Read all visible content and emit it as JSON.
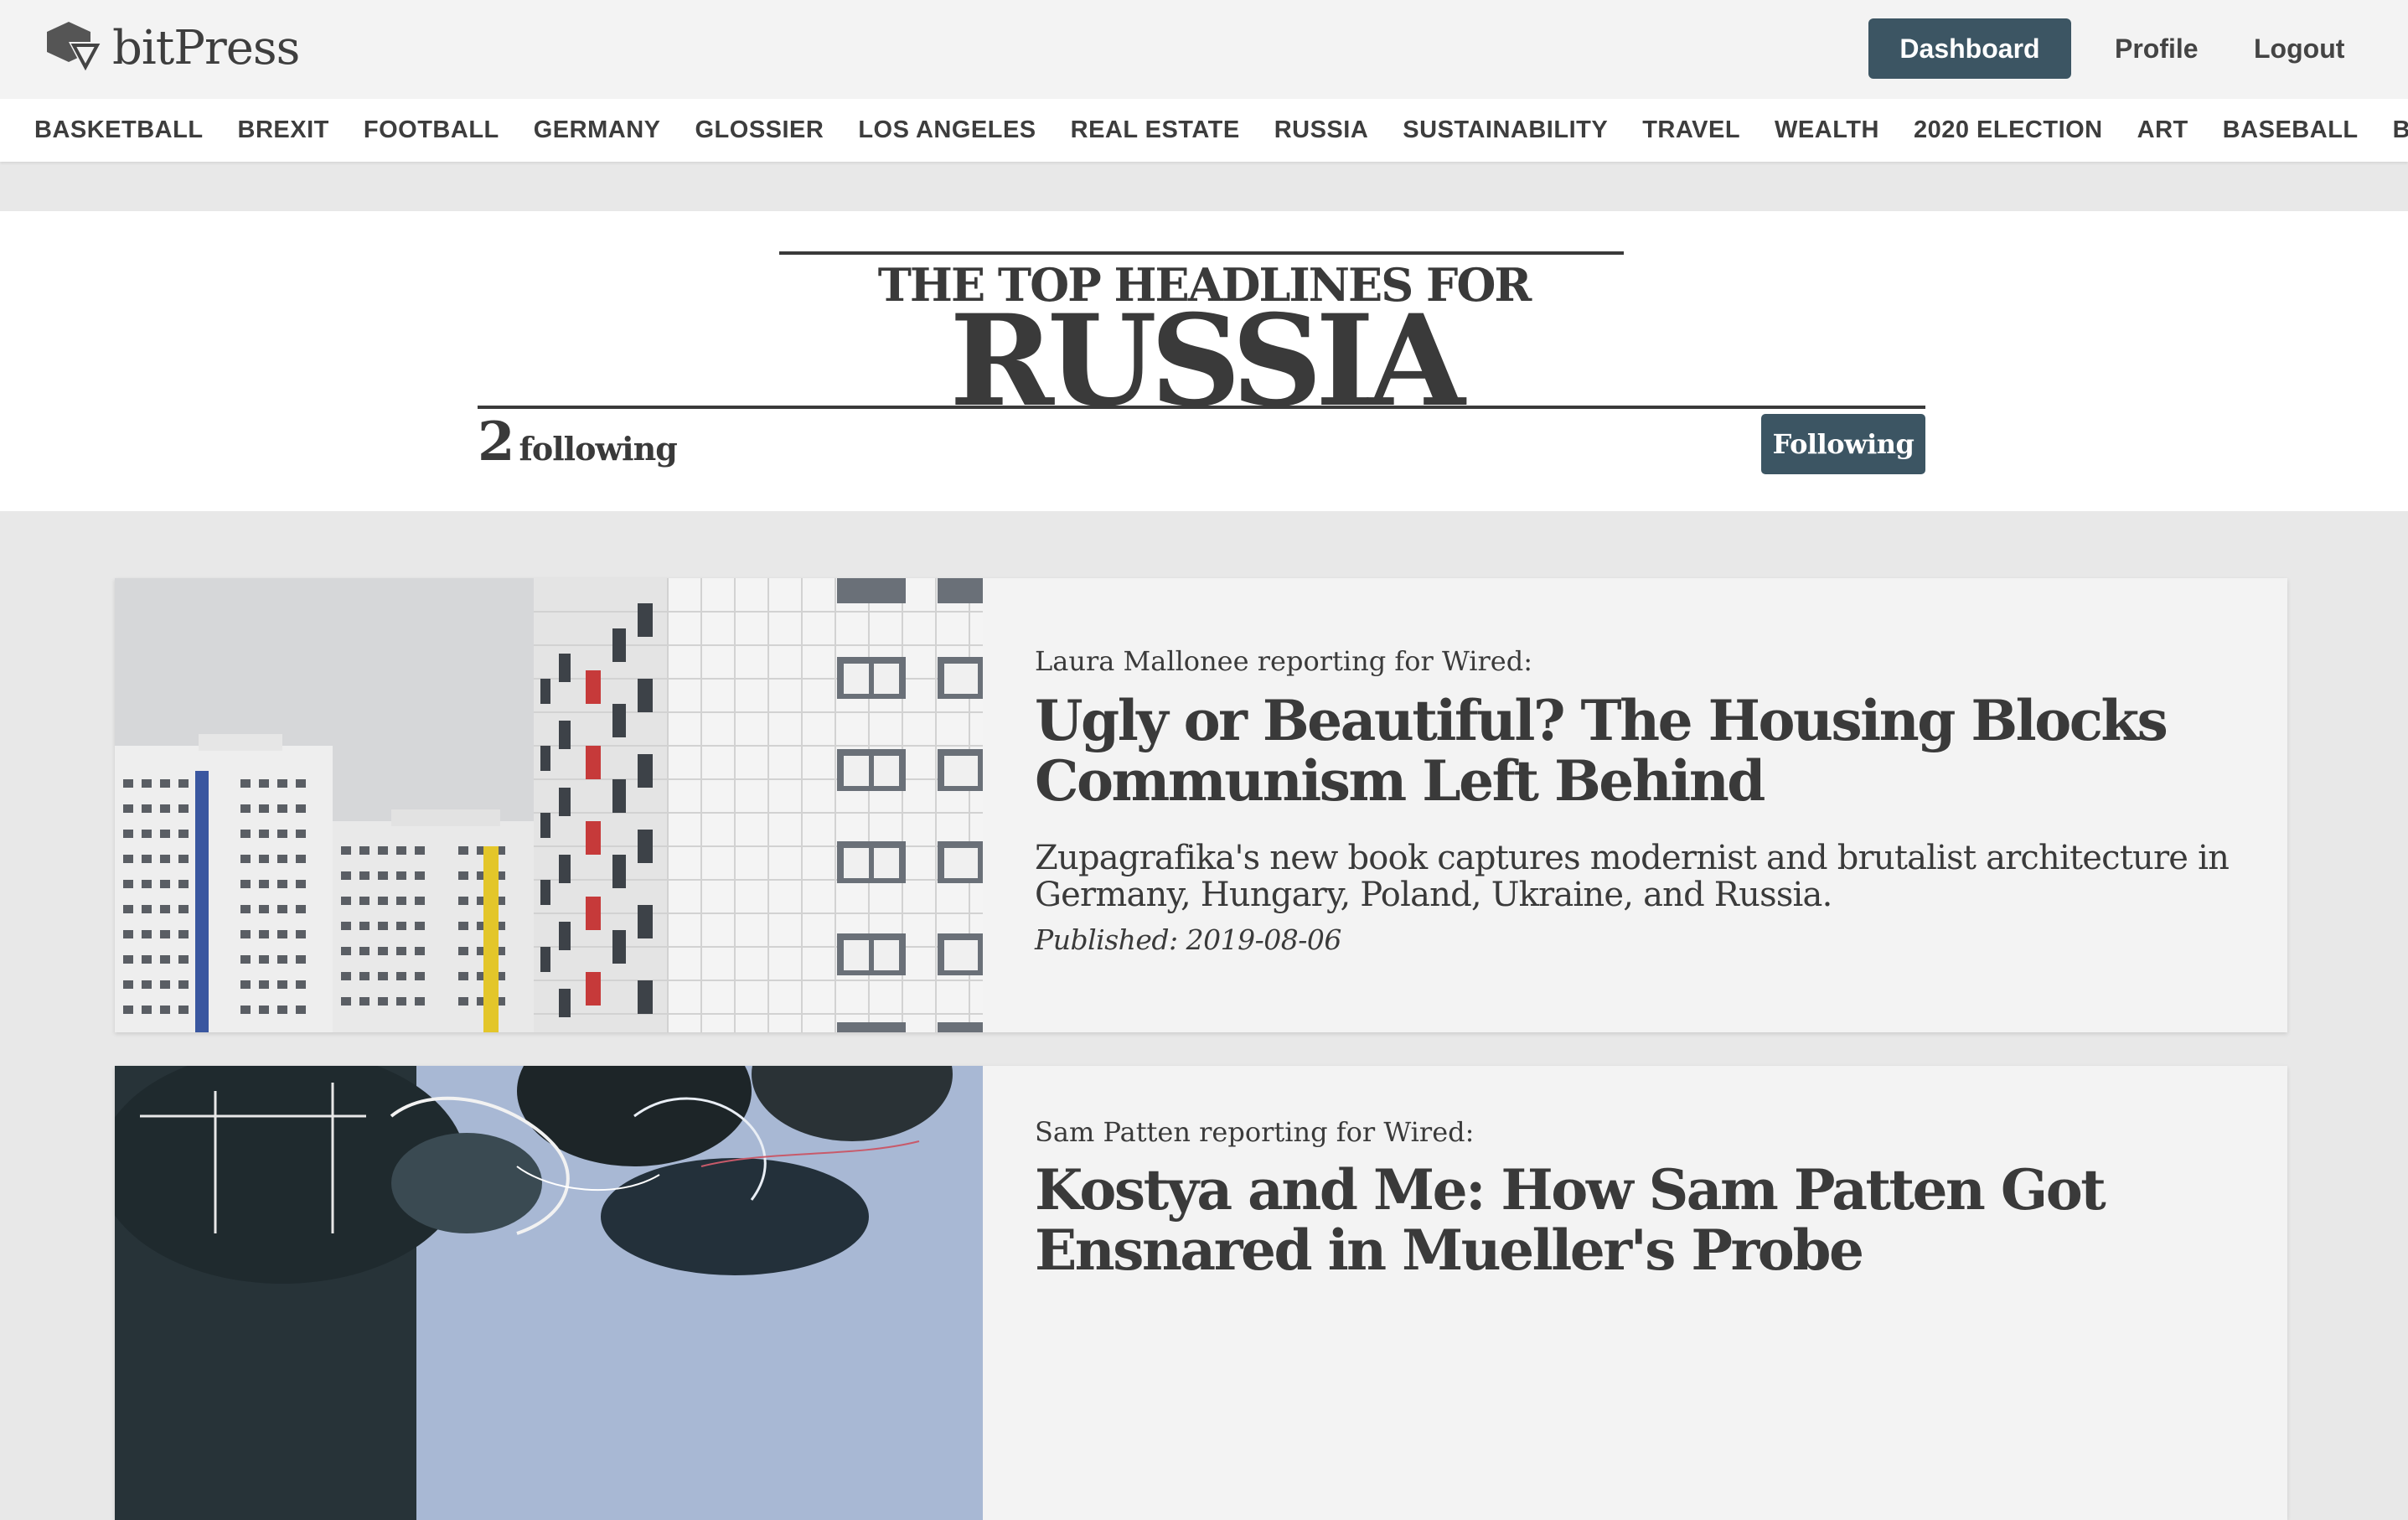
{
  "header": {
    "brand": "bitPress",
    "dashboard_label": "Dashboard",
    "profile_label": "Profile",
    "logout_label": "Logout",
    "accent_color": "#3c5563"
  },
  "topics": [
    "BASKETBALL",
    "BREXIT",
    "FOOTBALL",
    "GERMANY",
    "GLOSSIER",
    "LOS ANGELES",
    "REAL ESTATE",
    "RUSSIA",
    "SUSTAINABILITY",
    "TRAVEL",
    "WEALTH",
    "2020 ELECTION",
    "ART",
    "BASEBALL",
    "BEAUTY"
  ],
  "headline": {
    "pre_title": "THE TOP HEADLINES FOR",
    "topic": "RUSSIA",
    "follow_count": "2",
    "follow_label": "following",
    "following_button": "Following"
  },
  "articles": [
    {
      "byline": "Laura Mallonee reporting for Wired:",
      "title": "Ugly or Beautiful? The Housing Blocks Communism Left Behind",
      "summary": "Zupagrafika's new book captures modernist and brutalist architecture in Germany, Hungary, Poland, Ukraine, and Russia.",
      "published": "Published: 2019-08-06",
      "image": "housing-blocks-photo"
    },
    {
      "byline": "Sam Patten reporting for Wired:",
      "title": "Kostya and Me: How Sam Patten Got Ensnared in Mueller's Probe",
      "summary": "",
      "published": "",
      "image": "abstract-collage-illustration"
    }
  ]
}
